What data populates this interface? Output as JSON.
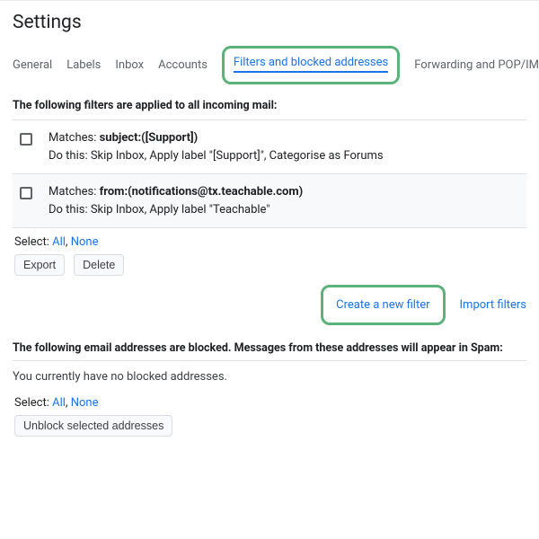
{
  "title": "Settings",
  "tabs": {
    "general": "General",
    "labels": "Labels",
    "inbox": "Inbox",
    "accounts": "Accounts",
    "filters": "Filters and blocked addresses",
    "forwarding": "Forwarding and POP/IMAP"
  },
  "filters_intro": "The following filters are applied to all incoming mail:",
  "filters": [
    {
      "matches_label": "Matches: ",
      "matches_val": "subject:([Support])",
      "dothis": "Do this: Skip Inbox, Apply label \"[Support]\", Categorise as Forums"
    },
    {
      "matches_label": "Matches: ",
      "matches_val": "from:(notifications@tx.teachable.com)",
      "dothis": "Do this: Skip Inbox, Apply label \"Teachable\""
    }
  ],
  "select": {
    "prefix": "Select: ",
    "all": "All",
    "sep": ", ",
    "none": "None"
  },
  "buttons": {
    "export": "Export",
    "delete": "Delete",
    "create": "Create a new filter",
    "import": "Import filters",
    "unblock": "Unblock selected addresses"
  },
  "blocked_intro": "The following email addresses are blocked. Messages from these addresses will appear in Spam:",
  "blocked_empty": "You currently have no blocked addresses."
}
